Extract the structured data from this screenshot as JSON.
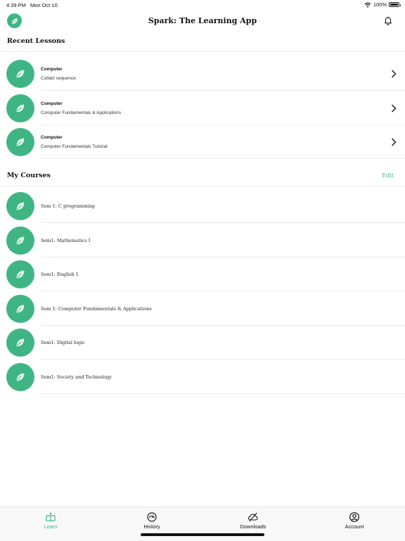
{
  "status": {
    "time": "4:39 PM",
    "date": "Mon Oct 10",
    "battery": "100%"
  },
  "header": {
    "title": "Spark: The Learning App"
  },
  "recent": {
    "title": "Recent Lessons",
    "items": [
      {
        "category": "Computer",
        "lesson": "Collatz sequence"
      },
      {
        "category": "Computer",
        "lesson": "Computer Fundamentals & Applications"
      },
      {
        "category": "Computer",
        "lesson": "Computer Fundamentals Tutorial"
      }
    ]
  },
  "courses": {
    "title": "My Courses",
    "edit_label": "Edit",
    "items": [
      {
        "name": "Sem 1:  C programming"
      },
      {
        "name": "Sem1: Mathematics I"
      },
      {
        "name": "Sem1: English 1"
      },
      {
        "name": "Sem 1: Computer Fundamentals & Applications"
      },
      {
        "name": "Sem1:  Digital logic"
      },
      {
        "name": "Sem1: Society and Technology"
      }
    ]
  },
  "tabs": [
    {
      "label": "Learn",
      "icon": "learn-book-icon",
      "active": true
    },
    {
      "label": "History",
      "icon": "gauge-icon",
      "active": false
    },
    {
      "label": "Downloads",
      "icon": "cloud-off-icon",
      "active": false
    },
    {
      "label": "Account",
      "icon": "user-circle-icon",
      "active": false
    }
  ],
  "colors": {
    "accent": "#3fb584"
  }
}
